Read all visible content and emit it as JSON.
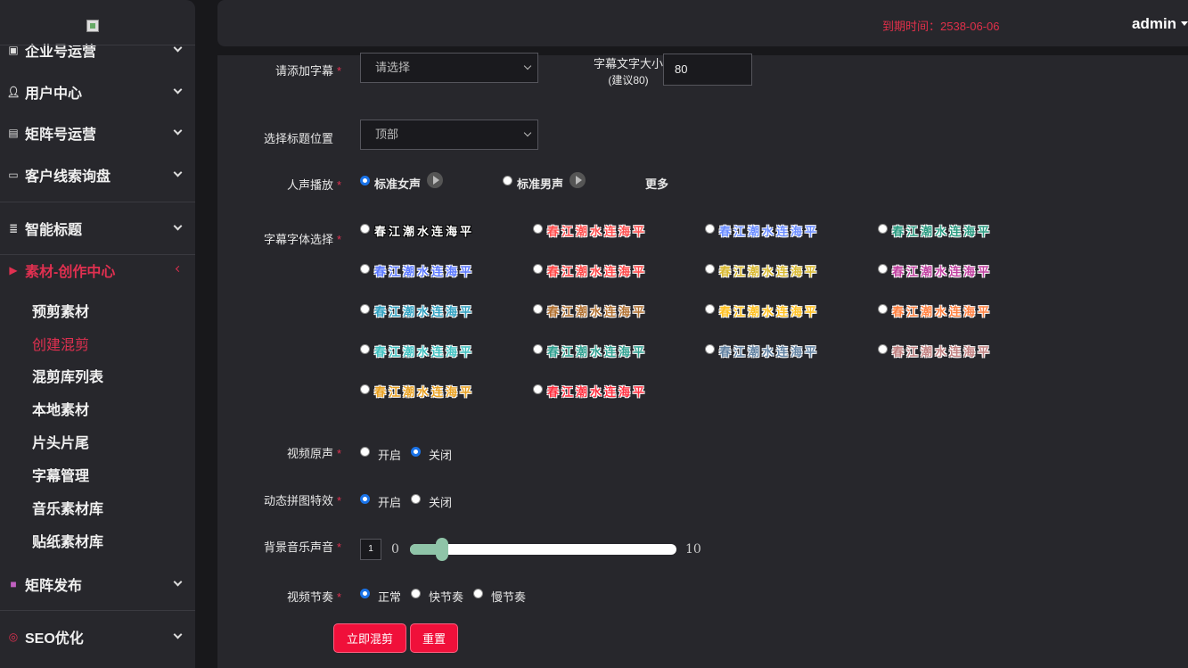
{
  "header": {
    "expire_text": "到期时间：2538-06-06",
    "user": "admin"
  },
  "sidebar": {
    "items": [
      {
        "label": "企业号运营",
        "icon": "id-card-icon"
      },
      {
        "label": "用户中心",
        "icon": "user-icon"
      },
      {
        "label": "矩阵号运营",
        "icon": "contact-card-icon"
      },
      {
        "label": "客户线索询盘",
        "icon": "image-icon"
      },
      {
        "label": "智能标题",
        "icon": "list-icon"
      },
      {
        "label": "素材-创作中心",
        "icon": "video-icon",
        "active": true
      },
      {
        "label": "矩阵发布",
        "icon": "camera-icon"
      },
      {
        "label": "SEO优化",
        "icon": "target-icon"
      }
    ],
    "subitems": [
      {
        "label": "预剪素材"
      },
      {
        "label": "创建混剪",
        "active": true
      },
      {
        "label": "混剪库列表"
      },
      {
        "label": "本地素材"
      },
      {
        "label": "片头片尾"
      },
      {
        "label": "字幕管理"
      },
      {
        "label": "音乐素材库"
      },
      {
        "label": "贴纸素材库"
      }
    ]
  },
  "form": {
    "subtitle": {
      "label": "请添加字幕",
      "placeholder": "请选择"
    },
    "font_size": {
      "label_line1": "字幕文字大小",
      "label_line2": "(建议80)",
      "value": "80"
    },
    "title_position": {
      "label": "选择标题位置",
      "value": "顶部"
    },
    "voice": {
      "label": "人声播放",
      "options": [
        "标准女声",
        "标准男声"
      ],
      "selected": 0,
      "more": "更多"
    },
    "subtitle_font": {
      "label": "字幕字体选择",
      "sample_text": "春江潮水连海平",
      "selected": 21
    },
    "video_audio": {
      "label": "视频原声",
      "options": [
        "开启",
        "关闭"
      ],
      "selected": 1
    },
    "dynamic_effect": {
      "label": "动态拼图特效",
      "options": [
        "开启",
        "关闭"
      ],
      "selected": 0
    },
    "bgm_volume": {
      "label": "背景音乐声音",
      "value": "1",
      "min": "0",
      "max": "10"
    },
    "rhythm": {
      "label": "视频节奏",
      "options": [
        "正常",
        "快节奏",
        "慢节奏"
      ],
      "selected": 0
    },
    "buttons": {
      "submit": "立即混剪",
      "reset": "重置"
    }
  },
  "colors": {
    "accent": "#e03050",
    "button": "#f0103a",
    "slider": "#8fc4a8",
    "radio": "#1a73e8"
  },
  "font_styles": [
    {
      "fill": "#ffffff",
      "stroke": "#000000"
    },
    {
      "fill": "#ff5050",
      "stroke": "#ffffff"
    },
    {
      "fill": "#6a8cff",
      "stroke": "#ffffff"
    },
    {
      "fill": "#2a9a80",
      "stroke": "#ffffff"
    },
    {
      "fill": "#5a78ff",
      "stroke": "#ffffff"
    },
    {
      "fill": "#ff4848",
      "stroke": "#ffffff"
    },
    {
      "fill": "#d8b830",
      "stroke": "#ffffff"
    },
    {
      "fill": "#c040a0",
      "stroke": "#ffffff"
    },
    {
      "fill": "#30a0c0",
      "stroke": "#ffffff"
    },
    {
      "fill": "#b07030",
      "stroke": "#ffffff"
    },
    {
      "fill": "#ffc020",
      "stroke": "#ffffff"
    },
    {
      "fill": "#ff8040",
      "stroke": "#ffffff"
    },
    {
      "fill": "#40c0c0",
      "stroke": "#ffffff"
    },
    {
      "fill": "#30a090",
      "stroke": "#ffffff"
    },
    {
      "fill": "#6080a0",
      "stroke": "#ffffff"
    },
    {
      "fill": "#c08080",
      "stroke": "#ffffff"
    },
    {
      "fill": "#e8a020",
      "stroke": "#ffffff"
    },
    {
      "fill": "#ff3040",
      "stroke": "#ffffff"
    }
  ]
}
